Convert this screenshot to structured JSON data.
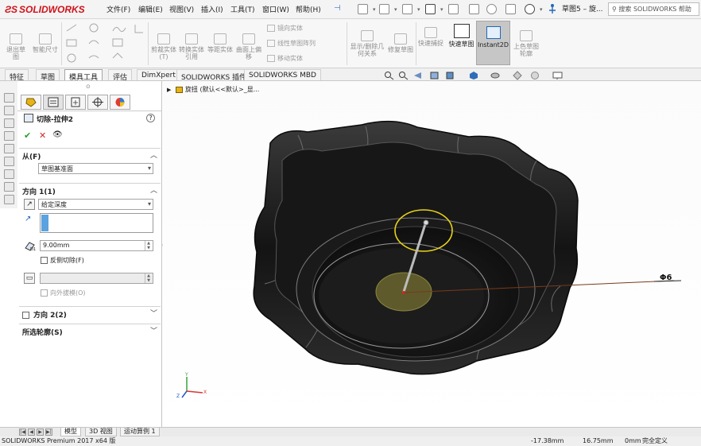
{
  "app": {
    "brand": "SOLIDWORKS",
    "doc_title": "草图5 – 旋...",
    "search_placeholder": "搜索 SOLIDWORKS 帮助"
  },
  "menu": [
    {
      "label": "文件(F)"
    },
    {
      "label": "编辑(E)"
    },
    {
      "label": "视图(V)"
    },
    {
      "label": "插入(I)"
    },
    {
      "label": "工具(T)"
    },
    {
      "label": "窗口(W)"
    },
    {
      "label": "帮助(H)"
    }
  ],
  "ribbon": {
    "exit_sketch": "退出草图",
    "smart_dim": "智能尺寸",
    "trim": "剪裁实体(T)",
    "convert": "转换实体引用",
    "offset": "等距实体",
    "surface_offset": "曲面上偏移",
    "mirror": "镜向实体",
    "linear_pattern": "线性草图阵列",
    "move": "移动实体",
    "show_relations": "显示/删除几何关系",
    "repair": "修复草图",
    "quick_snap": "快速捕捉",
    "rapid_sketch": "快速草图",
    "instant2d": "Instant2D",
    "shaded_sketch": "上色草图轮廓"
  },
  "tabs": [
    {
      "label": "特征"
    },
    {
      "label": "草图"
    },
    {
      "label": "模具工具"
    },
    {
      "label": "评估"
    },
    {
      "label": "DimXpert"
    },
    {
      "label": "SOLIDWORKS 插件"
    },
    {
      "label": "SOLIDWORKS MBD"
    }
  ],
  "property_manager": {
    "title": "切除-拉伸2",
    "from_label": "从(F)",
    "from_value": "草图基准面",
    "dir1_label": "方向 1(1)",
    "end_condition": "给定深度",
    "depth": "9.00mm",
    "flip_side": "反侧切除(F)",
    "draft_outward": "向外拔模(O)",
    "dir2_label": "方向 2(2)",
    "contours_label": "所选轮廓(S)"
  },
  "tree": {
    "item": "旋扭 (默认<<默认>_显..."
  },
  "dimension_label": "Φ6",
  "triad": {
    "x": "X",
    "y": "Y",
    "z": "Z"
  },
  "bottom_tabs": [
    {
      "label": "模型"
    },
    {
      "label": "3D 视图"
    },
    {
      "label": "运动算例 1"
    }
  ],
  "status": {
    "product": "SOLIDWORKS Premium 2017 x64 版",
    "x": "-17.38mm",
    "y": "16.75mm",
    "z": "0mm",
    "state": "完全定义"
  },
  "colors": {
    "brand_red": "#d0121b",
    "accent_blue": "#2467b4",
    "body": "#1b1b1b",
    "highlight": "#e8d21a",
    "face_olive": "#5e5a2c"
  }
}
